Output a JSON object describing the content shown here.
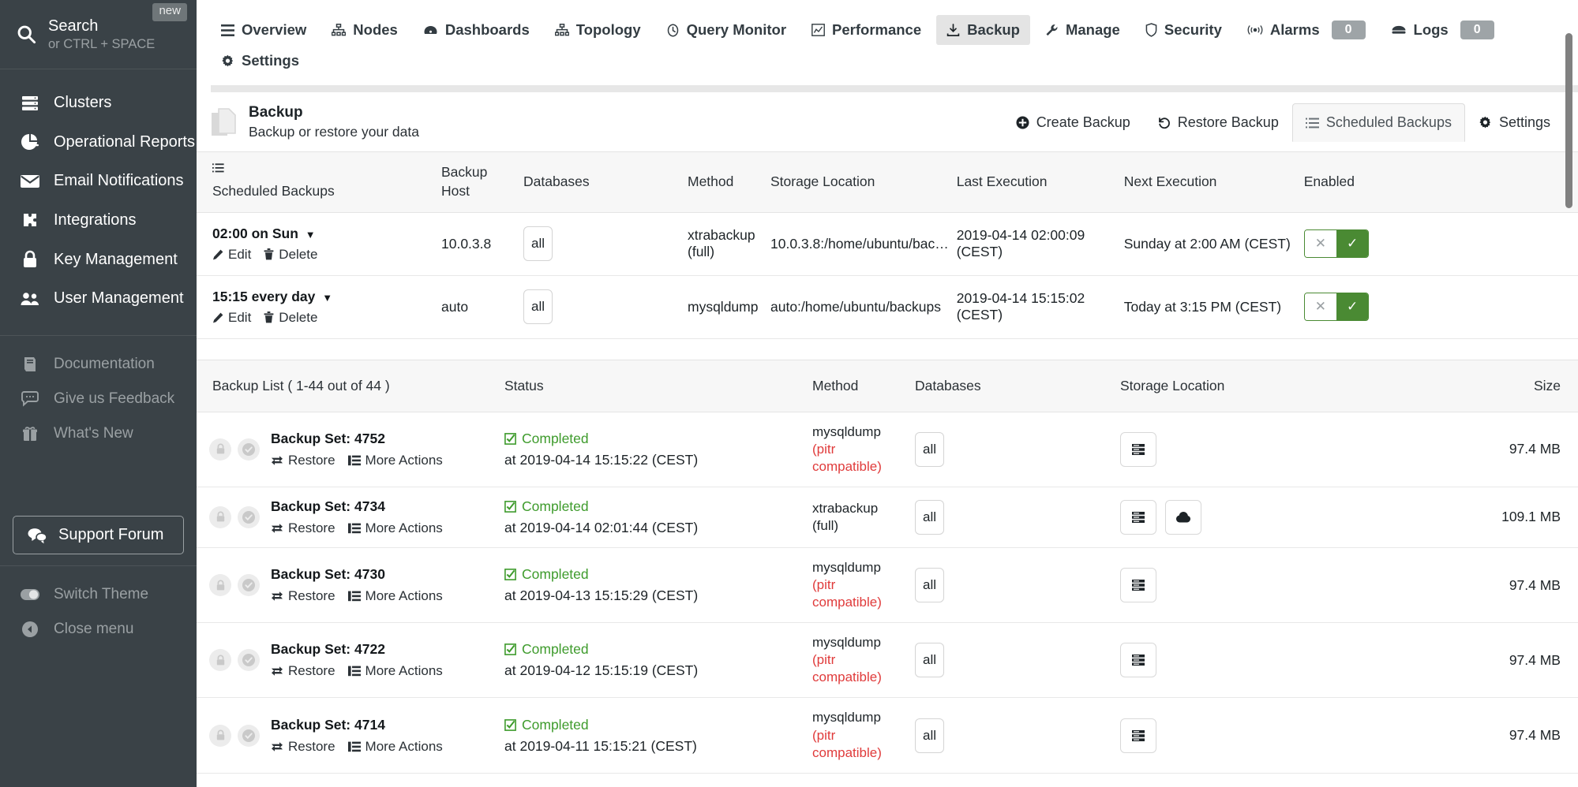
{
  "sidebar": {
    "search": {
      "badge": "new",
      "title": "Search",
      "subtitle": "or CTRL + SPACE",
      "icon": "search-icon"
    },
    "primary_items": [
      {
        "label": "Clusters",
        "icon": "servers-icon"
      },
      {
        "label": "Operational Reports",
        "icon": "pie-chart-icon"
      },
      {
        "label": "Email Notifications",
        "icon": "envelope-icon"
      },
      {
        "label": "Integrations",
        "icon": "puzzle-icon"
      },
      {
        "label": "Key Management",
        "icon": "lock-icon"
      },
      {
        "label": "User Management",
        "icon": "users-icon"
      }
    ],
    "secondary_items": [
      {
        "label": "Documentation",
        "icon": "book-icon"
      },
      {
        "label": "Give us Feedback",
        "icon": "comment-icon"
      },
      {
        "label": "What's New",
        "icon": "gift-icon"
      }
    ],
    "support": {
      "label": "Support Forum",
      "icon": "chat-icon"
    },
    "bottom_items": [
      {
        "label": "Switch Theme",
        "icon": "toggle-icon"
      },
      {
        "label": "Close menu",
        "icon": "chevron-left-circle-icon"
      }
    ]
  },
  "topnav": {
    "items": [
      {
        "label": "Overview",
        "icon": "list-icon",
        "active": false
      },
      {
        "label": "Nodes",
        "icon": "nodes-icon",
        "active": false
      },
      {
        "label": "Dashboards",
        "icon": "dashboard-icon",
        "active": false
      },
      {
        "label": "Topology",
        "icon": "topology-icon",
        "active": false
      },
      {
        "label": "Query Monitor",
        "icon": "clock-icon",
        "active": false
      },
      {
        "label": "Performance",
        "icon": "chart-icon",
        "active": false
      },
      {
        "label": "Backup",
        "icon": "download-icon",
        "active": true
      },
      {
        "label": "Manage",
        "icon": "wrench-icon",
        "active": false
      },
      {
        "label": "Security",
        "icon": "shield-icon",
        "active": false
      },
      {
        "label": "Alarms",
        "icon": "broadcast-icon",
        "active": false,
        "count": "0"
      },
      {
        "label": "Logs",
        "icon": "archive-icon",
        "active": false,
        "count": "0"
      }
    ],
    "settings": {
      "label": "Settings",
      "icon": "gear-icon"
    }
  },
  "page": {
    "title": "Backup",
    "subtitle": "Backup or restore your data",
    "icon": "document-copy-icon",
    "actions": [
      {
        "label": "Create Backup",
        "icon": "plus-circle-icon",
        "selected": false
      },
      {
        "label": "Restore Backup",
        "icon": "undo-icon",
        "selected": false
      },
      {
        "label": "Scheduled Backups",
        "icon": "list-ordered-icon",
        "selected": true
      },
      {
        "label": "Settings",
        "icon": "gear-icon",
        "selected": false
      }
    ]
  },
  "scheduled": {
    "headers": {
      "name_icon": "list-ordered-icon",
      "name": "Scheduled Backups",
      "backup_host_line1": "Backup",
      "backup_host_line2": "Host",
      "databases": "Databases",
      "method": "Method",
      "storage_location": "Storage Location",
      "last_execution": "Last Execution",
      "next_execution": "Next Execution",
      "enabled": "Enabled"
    },
    "edit_label": "Edit",
    "delete_label": "Delete",
    "toggle_off": "✕",
    "toggle_on": "✓",
    "rows": [
      {
        "schedule": "02:00 on Sun",
        "host": "10.0.3.8",
        "databases": "all",
        "method_line1": "xtrabackup",
        "method_line2": "(full)",
        "storage": "10.0.3.8:/home/ubuntu/bac…",
        "last_execution": "2019-04-14 02:00:09 (CEST)",
        "next_execution": "Sunday at 2:00 AM (CEST)",
        "enabled": true
      },
      {
        "schedule": "15:15 every day",
        "host": "auto",
        "databases": "all",
        "method_line1": "mysqldump",
        "method_line2": "",
        "storage": "auto:/home/ubuntu/backups",
        "last_execution": "2019-04-14 15:15:02 (CEST)",
        "next_execution": "Today at 3:15 PM (CEST)",
        "enabled": true
      }
    ]
  },
  "backup_list": {
    "headers": {
      "title": "Backup List ( 1-44 out of 44 )",
      "status": "Status",
      "method": "Method",
      "databases": "Databases",
      "storage_location": "Storage Location",
      "size": "Size"
    },
    "restore_label": "Restore",
    "more_actions_label": "More Actions",
    "rows": [
      {
        "name": "Backup Set: 4752",
        "status": "Completed",
        "status_time": "at 2019-04-14 15:15:22 (CEST)",
        "method_line1": "mysqldump",
        "method_pitr1": "(pitr",
        "method_pitr2": "compatible)",
        "databases": "all",
        "storage_icons": [
          "server-icon"
        ],
        "size": "97.4 MB"
      },
      {
        "name": "Backup Set: 4734",
        "status": "Completed",
        "status_time": "at 2019-04-14 02:01:44 (CEST)",
        "method_line1": "xtrabackup",
        "method_pitr1": "",
        "method_pitr2": "",
        "method_line2": "(full)",
        "databases": "all",
        "storage_icons": [
          "server-icon",
          "cloud-icon"
        ],
        "size": "109.1 MB"
      },
      {
        "name": "Backup Set: 4730",
        "status": "Completed",
        "status_time": "at 2019-04-13 15:15:29 (CEST)",
        "method_line1": "mysqldump",
        "method_pitr1": "(pitr",
        "method_pitr2": "compatible)",
        "databases": "all",
        "storage_icons": [
          "server-icon"
        ],
        "size": "97.4 MB"
      },
      {
        "name": "Backup Set: 4722",
        "status": "Completed",
        "status_time": "at 2019-04-12 15:15:19 (CEST)",
        "method_line1": "mysqldump",
        "method_pitr1": "(pitr",
        "method_pitr2": "compatible)",
        "databases": "all",
        "storage_icons": [
          "server-icon"
        ],
        "size": "97.4 MB"
      },
      {
        "name": "Backup Set: 4714",
        "status": "Completed",
        "status_time": "at 2019-04-11 15:15:21 (CEST)",
        "method_line1": "mysqldump",
        "method_pitr1": "(pitr",
        "method_pitr2": "compatible)",
        "databases": "all",
        "storage_icons": [
          "server-icon"
        ],
        "size": "97.4 MB"
      }
    ]
  }
}
